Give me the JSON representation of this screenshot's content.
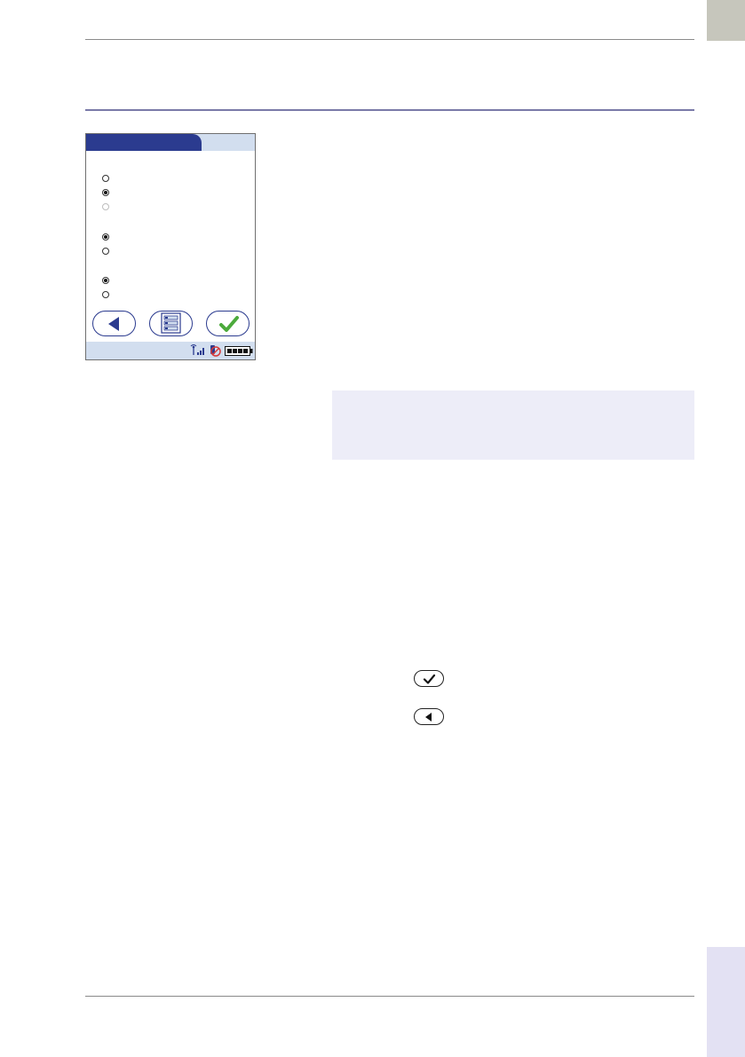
{
  "colors": {
    "tab_gray": "#c6c6bc",
    "tab_lavender": "#e3e1f3",
    "accent_rule": "#7a7aa8",
    "screen_navy": "#2b3b8f",
    "screen_light": "#d2deef",
    "note_bg": "#ededf8",
    "check_green": "#4caa3c"
  },
  "device_screen": {
    "radio_groups": [
      {
        "options": [
          {
            "state": "unselected"
          },
          {
            "state": "selected"
          },
          {
            "state": "disabled"
          }
        ]
      },
      {
        "options": [
          {
            "state": "selected"
          },
          {
            "state": "unselected"
          }
        ]
      },
      {
        "options": [
          {
            "state": "selected"
          },
          {
            "state": "unselected"
          }
        ]
      }
    ],
    "buttons": [
      {
        "icon": "back-arrow-icon"
      },
      {
        "icon": "menu-list-icon"
      },
      {
        "icon": "checkmark-icon"
      }
    ],
    "status_icons": [
      "antenna-signal-icon",
      "no-connection-icon",
      "battery-icon"
    ]
  },
  "inline_icons": [
    "confirm-check-button-icon",
    "back-arrow-button-icon"
  ]
}
